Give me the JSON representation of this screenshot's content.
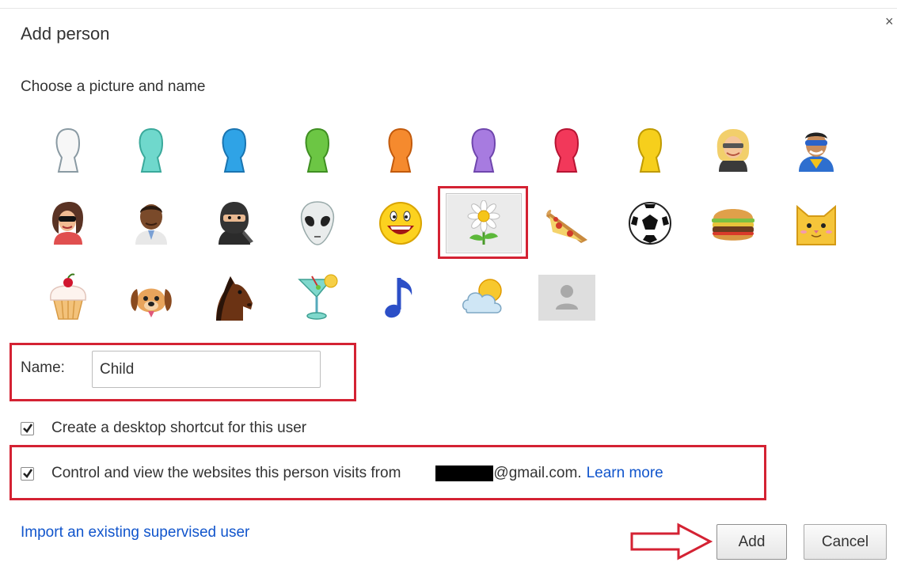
{
  "dialog": {
    "title": "Add person",
    "close_glyph": "×",
    "subtitle": "Choose a picture and name"
  },
  "avatars": [
    {
      "name": "white-silhouette"
    },
    {
      "name": "teal-silhouette"
    },
    {
      "name": "blue-silhouette"
    },
    {
      "name": "green-silhouette"
    },
    {
      "name": "orange-silhouette"
    },
    {
      "name": "purple-silhouette"
    },
    {
      "name": "red-silhouette"
    },
    {
      "name": "yellow-silhouette"
    },
    {
      "name": "blonde-businesswoman"
    },
    {
      "name": "superhero"
    },
    {
      "name": "woman-sunglasses"
    },
    {
      "name": "man"
    },
    {
      "name": "ninja"
    },
    {
      "name": "alien"
    },
    {
      "name": "smiley-face"
    },
    {
      "name": "flower",
      "selected": true
    },
    {
      "name": "pizza"
    },
    {
      "name": "soccer-ball"
    },
    {
      "name": "burger"
    },
    {
      "name": "cat"
    },
    {
      "name": "cupcake"
    },
    {
      "name": "dog"
    },
    {
      "name": "horse"
    },
    {
      "name": "cocktail"
    },
    {
      "name": "music-note"
    },
    {
      "name": "sun-cloud"
    },
    {
      "name": "generic-person"
    }
  ],
  "name_field": {
    "label": "Name:",
    "value": "Child"
  },
  "shortcut_option": {
    "label": "Create a desktop shortcut for this user",
    "checked": true
  },
  "supervise_option": {
    "label": "Control and view the websites this person visits from",
    "email_suffix": "@gmail.com.",
    "learn_more": "Learn more",
    "checked": true
  },
  "import_link": "Import an existing supervised user",
  "buttons": {
    "add": "Add",
    "cancel": "Cancel"
  },
  "colors": {
    "highlight": "#d42233",
    "link": "#1155cc"
  }
}
